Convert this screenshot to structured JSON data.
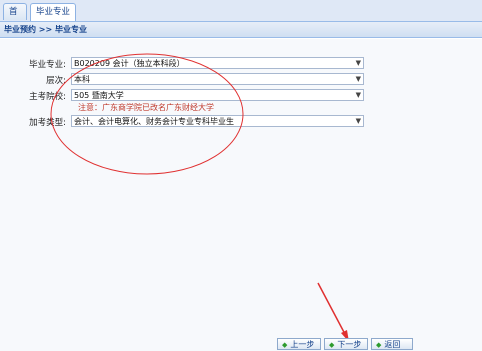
{
  "tabs": [
    {
      "label": "首页"
    },
    {
      "label": "毕业专业",
      "close": "×"
    }
  ],
  "breadcrumb": "毕业预约 >> 毕业专业",
  "form": {
    "major_label": "毕业专业:",
    "major_value": "B020209 会计（独立本科段）",
    "level_label": "层次:",
    "level_value": "本科",
    "school_label": "主考院校:",
    "school_value": "505 暨南大学",
    "note": "注意：广东商学院已改名广东财经大学",
    "type_label": "加考类型:",
    "type_value": "会计、会计电算化、财务会计专业专科毕业生"
  },
  "buttons": {
    "prev": "上一步",
    "next": "下一步",
    "back": "返回"
  },
  "colors": {
    "annotation": "#e03030",
    "tab_border": "#8db2e3",
    "accent": "#15428b"
  }
}
